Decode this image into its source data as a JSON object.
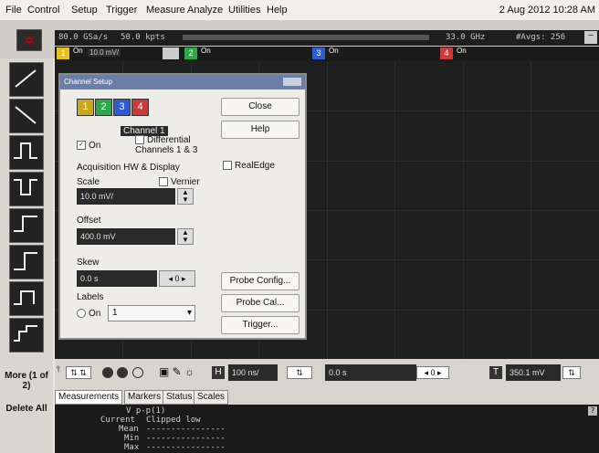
{
  "menu": [
    "File",
    "Control",
    "Setup",
    "Trigger",
    "Measure",
    "Analyze",
    "Utilities",
    "Help"
  ],
  "datetime": "2 Aug 2012 10:28 AM",
  "acq": {
    "sample_rate": "80.0 GSa/s",
    "memory": "50.0 kpts",
    "bandwidth": "33.0 GHz",
    "averages": "#Avgs: 256"
  },
  "channels": [
    {
      "num": "1",
      "state": "On",
      "value": "10.0 mV/",
      "color": "#e6c21a"
    },
    {
      "num": "2",
      "state": "On",
      "color": "#2aa84a"
    },
    {
      "num": "3",
      "state": "On",
      "color": "#2f5bd0"
    },
    {
      "num": "4",
      "state": "On",
      "color": "#c93b3b"
    }
  ],
  "left_tools": [
    "rising-ramp-icon",
    "falling-ramp-icon",
    "pulse-width-icon",
    "pulse-icon",
    "transition-icon",
    "edge-icon",
    "step-icon",
    "edge-then-edge-icon"
  ],
  "left_more": "More (1 of 2)",
  "left_delete": "Delete All",
  "dialog": {
    "title": "Channel Setup",
    "channel_buttons": [
      "1",
      "2",
      "3",
      "4"
    ],
    "channel_label": "Channel 1",
    "on_label": "On",
    "differential_label": "Differential Channels 1 & 3",
    "acq_heading": "Acquisition HW & Display",
    "scale_label": "Scale",
    "vernier_label": "Vernier",
    "scale_value": "10.0 mV/",
    "offset_label": "Offset",
    "offset_value": "400.0 mV",
    "skew_label": "Skew",
    "skew_value": "0.0 s",
    "skew_spin": "0",
    "labels_label": "Labels",
    "labels_on": "On",
    "labels_value": "1",
    "realedge_label": "RealEdge",
    "close_btn": "Close",
    "help_btn": "Help",
    "probe_config_btn": "Probe Config...",
    "probe_cal_btn": "Probe Cal...",
    "trigger_btn": "Trigger..."
  },
  "bottombar": {
    "time_scale": "100 ns/",
    "delay": "0.0 s",
    "delay_spin": "0",
    "trig_level": "350.1 mV"
  },
  "measurements": {
    "tabs": [
      "Measurements",
      "Markers",
      "Status",
      "Scales"
    ],
    "header": "V p-p(1)",
    "rows": [
      {
        "label": "Current",
        "value": "Clipped low"
      },
      {
        "label": "Mean",
        "value": "----------------"
      },
      {
        "label": "Min",
        "value": "----------------"
      },
      {
        "label": "Max",
        "value": "----------------"
      }
    ]
  }
}
